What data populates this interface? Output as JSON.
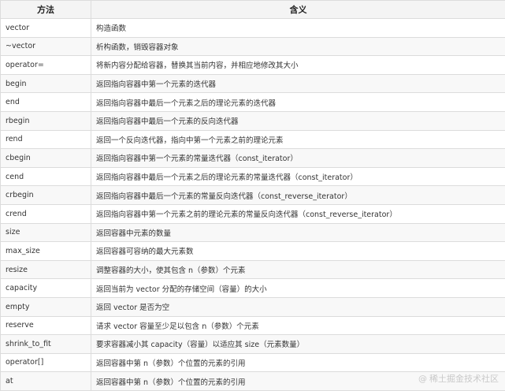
{
  "table": {
    "headers": [
      "方法",
      "含义"
    ],
    "rows": [
      [
        "vector",
        "构造函数"
      ],
      [
        "~vector",
        "析构函数，销毁容器对象"
      ],
      [
        "operator=",
        "将新内容分配给容器，替换其当前内容，并相应地修改其大小"
      ],
      [
        "begin",
        "返回指向容器中第一个元素的迭代器"
      ],
      [
        "end",
        "返回指向容器中最后一个元素之后的理论元素的迭代器"
      ],
      [
        "rbegin",
        "返回指向容器中最后一个元素的反向迭代器"
      ],
      [
        "rend",
        "返回一个反向迭代器，指向中第一个元素之前的理论元素"
      ],
      [
        "cbegin",
        "返回指向容器中第一个元素的常量迭代器（const_iterator）"
      ],
      [
        "cend",
        "返回指向容器中最后一个元素之后的理论元素的常量迭代器（const_iterator）"
      ],
      [
        "crbegin",
        "返回指向容器中最后一个元素的常量反向迭代器（const_reverse_iterator）"
      ],
      [
        "crend",
        "返回指向容器中第一个元素之前的理论元素的常量反向迭代器（const_reverse_iterator）"
      ],
      [
        "size",
        "返回容器中元素的数量"
      ],
      [
        "max_size",
        "返回容器可容纳的最大元素数"
      ],
      [
        "resize",
        "调整容器的大小，使其包含 n（参数）个元素"
      ],
      [
        "capacity",
        "返回当前为 vector 分配的存储空间（容量）的大小"
      ],
      [
        "empty",
        "返回 vector 是否为空"
      ],
      [
        "reserve",
        "请求 vector 容量至少足以包含 n（参数）个元素"
      ],
      [
        "shrink_to_fit",
        "要求容器减小其 capacity（容量）以适应其 size（元素数量）"
      ],
      [
        "operator[]",
        "返回容器中第 n（参数）个位置的元素的引用"
      ],
      [
        "at",
        "返回容器中第 n（参数）个位置的元素的引用"
      ]
    ]
  },
  "watermark": {
    "at": "@",
    "text": "稀土掘金技术社区"
  }
}
